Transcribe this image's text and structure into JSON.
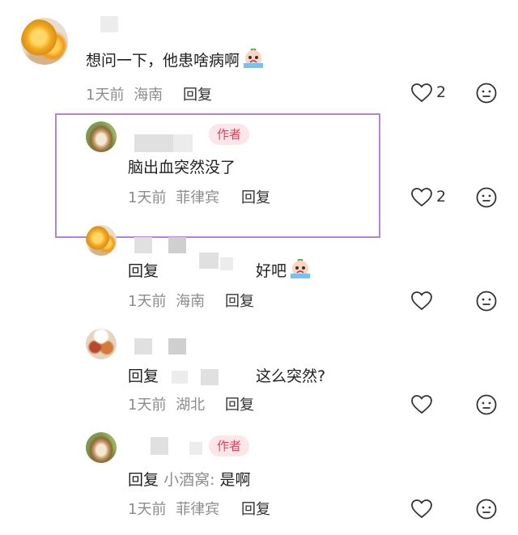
{
  "comments": [
    {
      "id": "c1",
      "text": "想问一下，他患啥病啊",
      "emoji": "crying-face-icon",
      "time": "1天前",
      "location": "海南",
      "reply_label": "回复",
      "likes": "2"
    },
    {
      "id": "r1",
      "author_badge": "作者",
      "text": "脑出血突然没了",
      "time": "1天前",
      "location": "菲律宾",
      "reply_label": "回复",
      "likes": "2"
    },
    {
      "id": "r2",
      "reply_prefix": "回复",
      "text": "好吧",
      "emoji": "crying-face-icon",
      "time": "1天前",
      "location": "海南",
      "reply_label": "回复"
    },
    {
      "id": "r3",
      "reply_prefix": "回复",
      "text": "这么突然?",
      "time": "1天前",
      "location": "湖北",
      "reply_label": "回复"
    },
    {
      "id": "r4",
      "author_badge": "作者",
      "reply_prefix": "回复",
      "mention": "小酒窝:",
      "text": "是啊",
      "time": "1天前",
      "location": "菲律宾",
      "reply_label": "回复"
    }
  ],
  "icons": {
    "like": "heart-icon",
    "react": "neutral-face-icon"
  },
  "colors": {
    "highlight_border": "#b084d8",
    "author_badge_bg": "#fde6ea",
    "author_badge_text": "#ee3a56",
    "meta_text": "#8c8c8c"
  }
}
